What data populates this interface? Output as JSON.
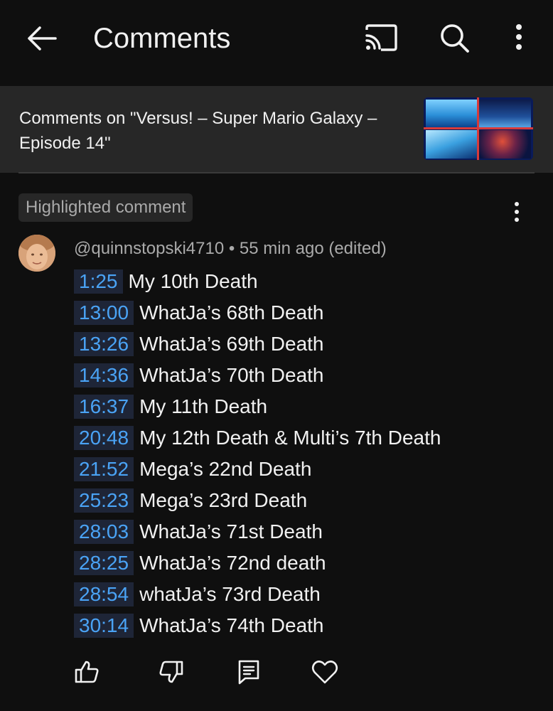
{
  "header": {
    "title": "Comments",
    "icons": [
      "back-arrow-icon",
      "cast-icon",
      "search-icon",
      "more-vert-icon"
    ]
  },
  "video": {
    "title": "Comments on \"Versus! – Super Mario Galaxy – Episode 14\""
  },
  "highlight_badge": "Highlighted comment",
  "comment": {
    "author": "@quinnstopski4710",
    "separator": "•",
    "age": "55 min ago (edited)",
    "lines": [
      {
        "time": "1:25",
        "text": "My 10th Death"
      },
      {
        "time": "13:00",
        "text": "WhatJa’s 68th Death"
      },
      {
        "time": "13:26",
        "text": "WhatJa’s 69th Death"
      },
      {
        "time": "14:36",
        "text": "WhatJa’s 70th Death"
      },
      {
        "time": "16:37",
        "text": "My 11th Death"
      },
      {
        "time": "20:48",
        "text": "My 12th Death & Multi’s 7th Death"
      },
      {
        "time": "21:52",
        "text": "Mega’s 22nd Death"
      },
      {
        "time": "25:23",
        "text": "Mega’s 23rd Death"
      },
      {
        "time": "28:03",
        "text": "WhatJa’s 71st Death"
      },
      {
        "time": "28:25",
        "text": "WhatJa’s 72nd death"
      },
      {
        "time": "28:54",
        "text": "whatJa’s 73rd Death"
      },
      {
        "time": "30:14",
        "text": "WhatJa’s 74th Death"
      }
    ]
  },
  "actions": [
    "like-icon",
    "dislike-icon",
    "reply-icon",
    "heart-icon"
  ],
  "colors": {
    "background": "#0f0f0f",
    "surface": "#272727",
    "timestamp_link": "#4aa3f5",
    "timestamp_bg": "#1e2537",
    "secondary_text": "#aaaaaa"
  }
}
